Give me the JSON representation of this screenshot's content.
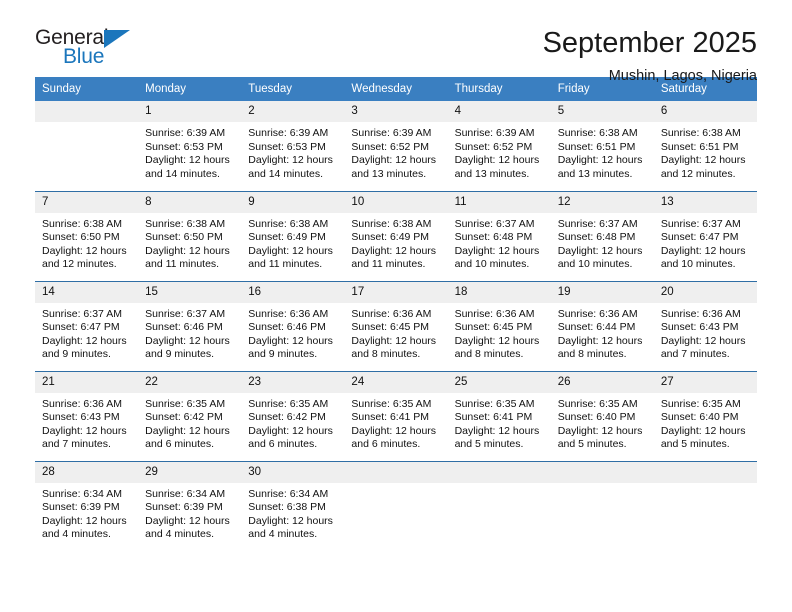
{
  "brand": {
    "name_part1": "General",
    "name_part2": "Blue"
  },
  "header": {
    "month_title": "September 2025",
    "location": "Mushin, Lagos, Nigeria"
  },
  "theme": {
    "header_blue": "#3a7fc1",
    "rule_blue": "#2f6ea5",
    "daynum_bg": "#efefef",
    "logo_blue": "#1b76bc"
  },
  "weekday_headers": [
    "Sunday",
    "Monday",
    "Tuesday",
    "Wednesday",
    "Thursday",
    "Friday",
    "Saturday"
  ],
  "labels": {
    "sunrise_prefix": "Sunrise:",
    "sunset_prefix": "Sunset:",
    "daylight_prefix": "Daylight:"
  },
  "weeks": [
    [
      {
        "day": "",
        "sunrise": "",
        "sunset": "",
        "daylight_a": "",
        "daylight_b": "",
        "empty": true
      },
      {
        "day": "1",
        "sunrise": "Sunrise: 6:39 AM",
        "sunset": "Sunset: 6:53 PM",
        "daylight_a": "Daylight: 12 hours",
        "daylight_b": "and 14 minutes.",
        "empty": false
      },
      {
        "day": "2",
        "sunrise": "Sunrise: 6:39 AM",
        "sunset": "Sunset: 6:53 PM",
        "daylight_a": "Daylight: 12 hours",
        "daylight_b": "and 14 minutes.",
        "empty": false
      },
      {
        "day": "3",
        "sunrise": "Sunrise: 6:39 AM",
        "sunset": "Sunset: 6:52 PM",
        "daylight_a": "Daylight: 12 hours",
        "daylight_b": "and 13 minutes.",
        "empty": false
      },
      {
        "day": "4",
        "sunrise": "Sunrise: 6:39 AM",
        "sunset": "Sunset: 6:52 PM",
        "daylight_a": "Daylight: 12 hours",
        "daylight_b": "and 13 minutes.",
        "empty": false
      },
      {
        "day": "5",
        "sunrise": "Sunrise: 6:38 AM",
        "sunset": "Sunset: 6:51 PM",
        "daylight_a": "Daylight: 12 hours",
        "daylight_b": "and 13 minutes.",
        "empty": false
      },
      {
        "day": "6",
        "sunrise": "Sunrise: 6:38 AM",
        "sunset": "Sunset: 6:51 PM",
        "daylight_a": "Daylight: 12 hours",
        "daylight_b": "and 12 minutes.",
        "empty": false
      }
    ],
    [
      {
        "day": "7",
        "sunrise": "Sunrise: 6:38 AM",
        "sunset": "Sunset: 6:50 PM",
        "daylight_a": "Daylight: 12 hours",
        "daylight_b": "and 12 minutes.",
        "empty": false
      },
      {
        "day": "8",
        "sunrise": "Sunrise: 6:38 AM",
        "sunset": "Sunset: 6:50 PM",
        "daylight_a": "Daylight: 12 hours",
        "daylight_b": "and 11 minutes.",
        "empty": false
      },
      {
        "day": "9",
        "sunrise": "Sunrise: 6:38 AM",
        "sunset": "Sunset: 6:49 PM",
        "daylight_a": "Daylight: 12 hours",
        "daylight_b": "and 11 minutes.",
        "empty": false
      },
      {
        "day": "10",
        "sunrise": "Sunrise: 6:38 AM",
        "sunset": "Sunset: 6:49 PM",
        "daylight_a": "Daylight: 12 hours",
        "daylight_b": "and 11 minutes.",
        "empty": false
      },
      {
        "day": "11",
        "sunrise": "Sunrise: 6:37 AM",
        "sunset": "Sunset: 6:48 PM",
        "daylight_a": "Daylight: 12 hours",
        "daylight_b": "and 10 minutes.",
        "empty": false
      },
      {
        "day": "12",
        "sunrise": "Sunrise: 6:37 AM",
        "sunset": "Sunset: 6:48 PM",
        "daylight_a": "Daylight: 12 hours",
        "daylight_b": "and 10 minutes.",
        "empty": false
      },
      {
        "day": "13",
        "sunrise": "Sunrise: 6:37 AM",
        "sunset": "Sunset: 6:47 PM",
        "daylight_a": "Daylight: 12 hours",
        "daylight_b": "and 10 minutes.",
        "empty": false
      }
    ],
    [
      {
        "day": "14",
        "sunrise": "Sunrise: 6:37 AM",
        "sunset": "Sunset: 6:47 PM",
        "daylight_a": "Daylight: 12 hours",
        "daylight_b": "and 9 minutes.",
        "empty": false
      },
      {
        "day": "15",
        "sunrise": "Sunrise: 6:37 AM",
        "sunset": "Sunset: 6:46 PM",
        "daylight_a": "Daylight: 12 hours",
        "daylight_b": "and 9 minutes.",
        "empty": false
      },
      {
        "day": "16",
        "sunrise": "Sunrise: 6:36 AM",
        "sunset": "Sunset: 6:46 PM",
        "daylight_a": "Daylight: 12 hours",
        "daylight_b": "and 9 minutes.",
        "empty": false
      },
      {
        "day": "17",
        "sunrise": "Sunrise: 6:36 AM",
        "sunset": "Sunset: 6:45 PM",
        "daylight_a": "Daylight: 12 hours",
        "daylight_b": "and 8 minutes.",
        "empty": false
      },
      {
        "day": "18",
        "sunrise": "Sunrise: 6:36 AM",
        "sunset": "Sunset: 6:45 PM",
        "daylight_a": "Daylight: 12 hours",
        "daylight_b": "and 8 minutes.",
        "empty": false
      },
      {
        "day": "19",
        "sunrise": "Sunrise: 6:36 AM",
        "sunset": "Sunset: 6:44 PM",
        "daylight_a": "Daylight: 12 hours",
        "daylight_b": "and 8 minutes.",
        "empty": false
      },
      {
        "day": "20",
        "sunrise": "Sunrise: 6:36 AM",
        "sunset": "Sunset: 6:43 PM",
        "daylight_a": "Daylight: 12 hours",
        "daylight_b": "and 7 minutes.",
        "empty": false
      }
    ],
    [
      {
        "day": "21",
        "sunrise": "Sunrise: 6:36 AM",
        "sunset": "Sunset: 6:43 PM",
        "daylight_a": "Daylight: 12 hours",
        "daylight_b": "and 7 minutes.",
        "empty": false
      },
      {
        "day": "22",
        "sunrise": "Sunrise: 6:35 AM",
        "sunset": "Sunset: 6:42 PM",
        "daylight_a": "Daylight: 12 hours",
        "daylight_b": "and 6 minutes.",
        "empty": false
      },
      {
        "day": "23",
        "sunrise": "Sunrise: 6:35 AM",
        "sunset": "Sunset: 6:42 PM",
        "daylight_a": "Daylight: 12 hours",
        "daylight_b": "and 6 minutes.",
        "empty": false
      },
      {
        "day": "24",
        "sunrise": "Sunrise: 6:35 AM",
        "sunset": "Sunset: 6:41 PM",
        "daylight_a": "Daylight: 12 hours",
        "daylight_b": "and 6 minutes.",
        "empty": false
      },
      {
        "day": "25",
        "sunrise": "Sunrise: 6:35 AM",
        "sunset": "Sunset: 6:41 PM",
        "daylight_a": "Daylight: 12 hours",
        "daylight_b": "and 5 minutes.",
        "empty": false
      },
      {
        "day": "26",
        "sunrise": "Sunrise: 6:35 AM",
        "sunset": "Sunset: 6:40 PM",
        "daylight_a": "Daylight: 12 hours",
        "daylight_b": "and 5 minutes.",
        "empty": false
      },
      {
        "day": "27",
        "sunrise": "Sunrise: 6:35 AM",
        "sunset": "Sunset: 6:40 PM",
        "daylight_a": "Daylight: 12 hours",
        "daylight_b": "and 5 minutes.",
        "empty": false
      }
    ],
    [
      {
        "day": "28",
        "sunrise": "Sunrise: 6:34 AM",
        "sunset": "Sunset: 6:39 PM",
        "daylight_a": "Daylight: 12 hours",
        "daylight_b": "and 4 minutes.",
        "empty": false
      },
      {
        "day": "29",
        "sunrise": "Sunrise: 6:34 AM",
        "sunset": "Sunset: 6:39 PM",
        "daylight_a": "Daylight: 12 hours",
        "daylight_b": "and 4 minutes.",
        "empty": false
      },
      {
        "day": "30",
        "sunrise": "Sunrise: 6:34 AM",
        "sunset": "Sunset: 6:38 PM",
        "daylight_a": "Daylight: 12 hours",
        "daylight_b": "and 4 minutes.",
        "empty": false
      },
      {
        "day": "",
        "sunrise": "",
        "sunset": "",
        "daylight_a": "",
        "daylight_b": "",
        "empty": true
      },
      {
        "day": "",
        "sunrise": "",
        "sunset": "",
        "daylight_a": "",
        "daylight_b": "",
        "empty": true
      },
      {
        "day": "",
        "sunrise": "",
        "sunset": "",
        "daylight_a": "",
        "daylight_b": "",
        "empty": true
      },
      {
        "day": "",
        "sunrise": "",
        "sunset": "",
        "daylight_a": "",
        "daylight_b": "",
        "empty": true
      }
    ]
  ]
}
